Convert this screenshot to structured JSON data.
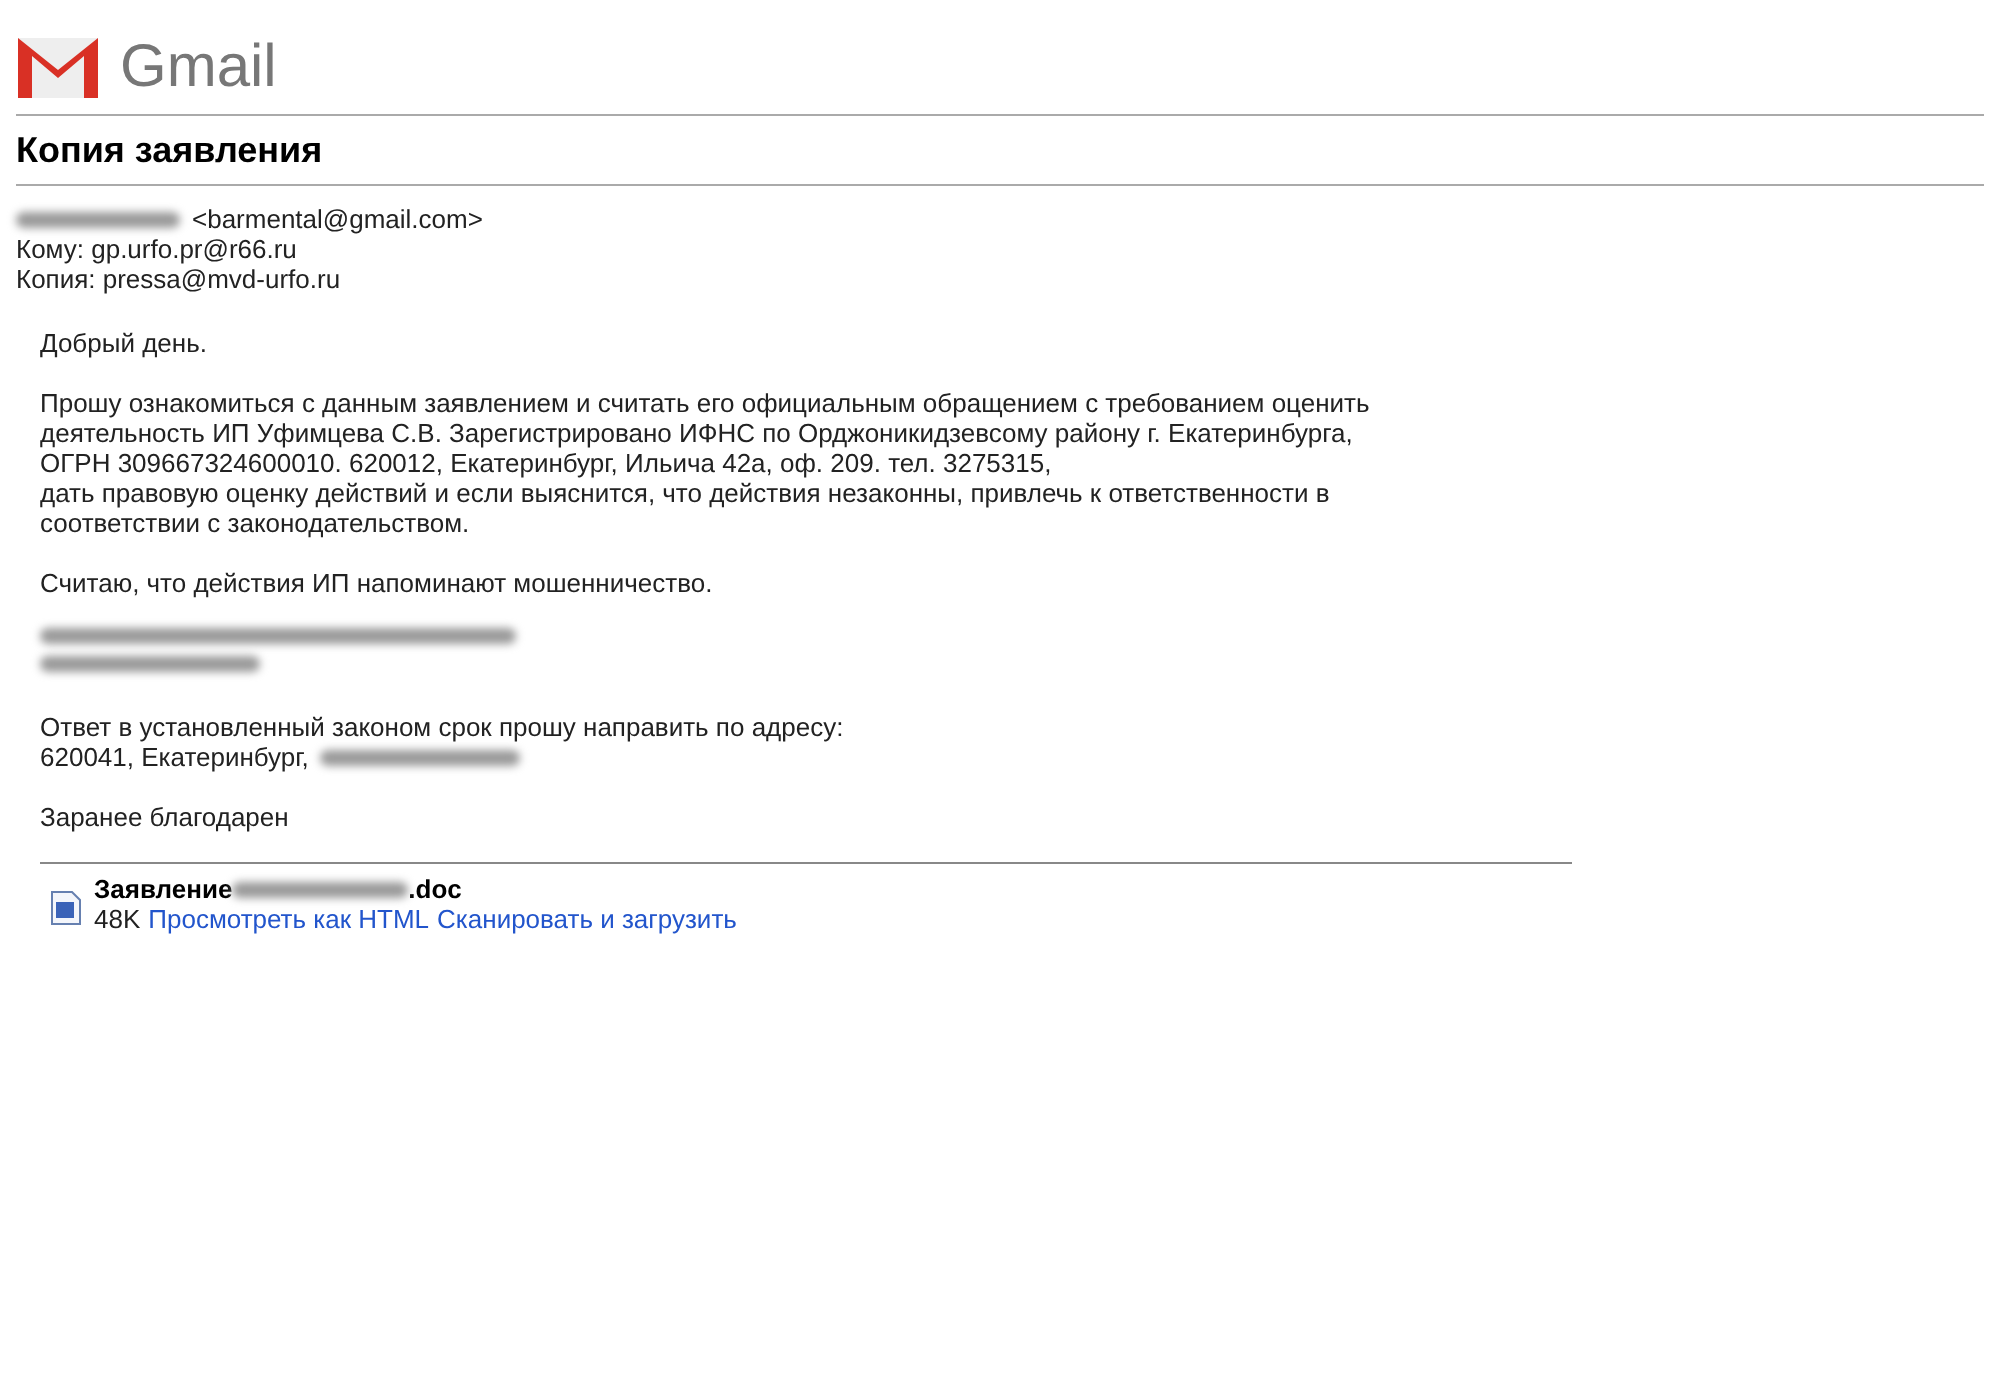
{
  "logo": {
    "text": "Gmail"
  },
  "subject": "Копия заявления",
  "from": {
    "address": "<barmental@gmail.com>"
  },
  "to": "Кому: gp.urfo.pr@r66.ru",
  "cc": "Копия: pressa@mvd-urfo.ru",
  "body": [
    {
      "kind": "text",
      "lines": [
        "Добрый день."
      ]
    },
    {
      "kind": "text",
      "lines": [
        "Прошу ознакомиться с данным заявлением и считать его официальным обращением с требованием оценить",
        "деятельность ИП Уфимцева С.В. Зарегистрировано ИФНС по Орджоникидзевсому району г. Екатеринбурга,",
        "ОГРН 309667324600010. 620012, Екатеринбург, Ильича 42а, оф. 209. тел. 3275315,",
        "дать правовую оценку действий и если выяснится, что действия незаконны, привлечь к ответственности в",
        "соответствии с законодательством."
      ]
    },
    {
      "kind": "text",
      "lines": [
        "Считаю, что действия ИП напоминают мошенничество."
      ]
    },
    {
      "kind": "redacted"
    },
    {
      "kind": "text",
      "lines": [
        "Ответ в установленный законом срок прошу направить по адресу:"
      ],
      "tail": "620041, Екатеринбург,"
    },
    {
      "kind": "text",
      "lines": [
        "Заранее благодарен"
      ]
    }
  ],
  "attachment": {
    "name_start": "Заявление",
    "name_end": ".doc",
    "size": "48K",
    "links": [
      "Просмотреть как HTML",
      "Сканировать и загрузить"
    ]
  }
}
